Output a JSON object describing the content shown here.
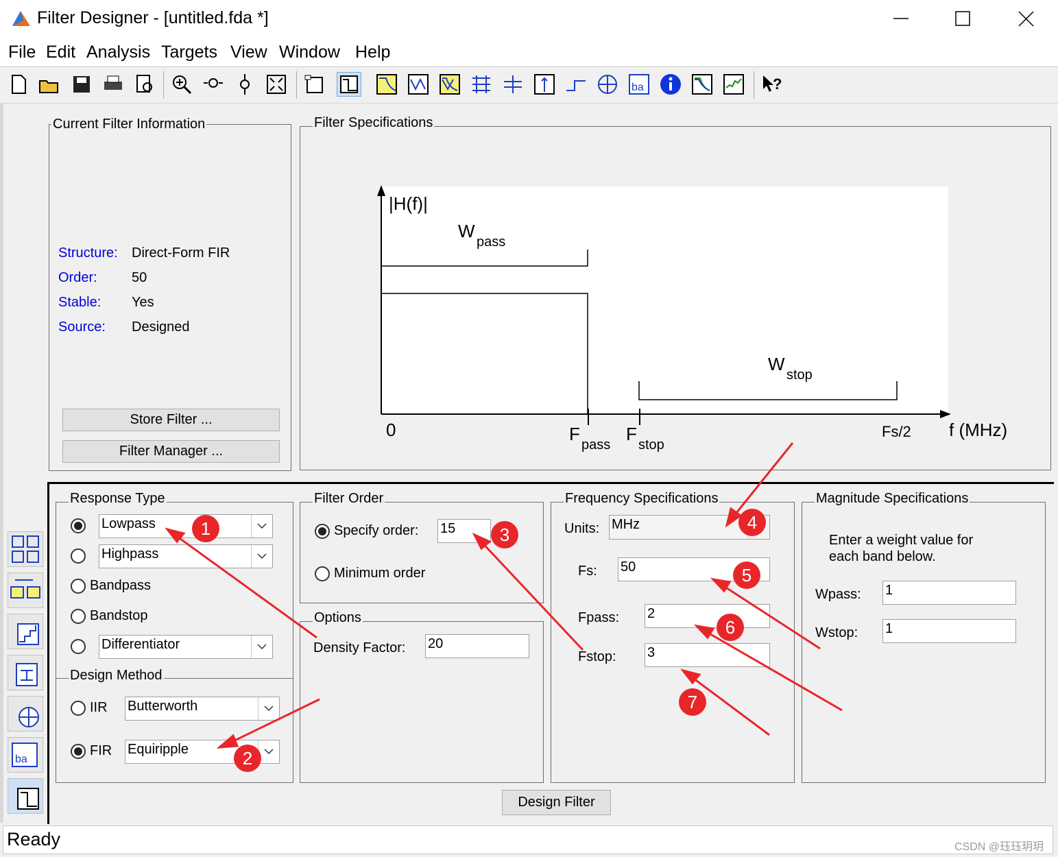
{
  "window": {
    "title": "Filter Designer -  [untitled.fda *]",
    "controls": {
      "minimize": "minimize-icon",
      "maximize": "maximize-icon",
      "close": "close-icon"
    }
  },
  "menu": [
    "File",
    "Edit",
    "Analysis",
    "Targets",
    "View",
    "Window",
    "Help"
  ],
  "toolbar_icons": [
    "new-icon",
    "open-icon",
    "save-icon",
    "print-icon",
    "print-preview-icon",
    "zoom-in-icon",
    "zoom-x-icon",
    "zoom-y-icon",
    "full-view-icon",
    "new-figure-icon",
    "filter-specs-icon",
    "magnitude-response-icon",
    "phase-response-icon",
    "magnitude-phase-icon",
    "group-delay-icon",
    "phase-delay-icon",
    "impulse-response-icon",
    "step-response-icon",
    "pole-zero-icon",
    "coefficients-icon",
    "filter-info-icon",
    "magnitude-estimate-icon",
    "round-off-noise-icon",
    "whats-this-icon"
  ],
  "current_filter": {
    "legend": "Current Filter Information",
    "structure_label": "Structure:",
    "structure_value": "Direct-Form FIR",
    "order_label": "Order:",
    "order_value": "50",
    "stable_label": "Stable:",
    "stable_value": "Yes",
    "source_label": "Source:",
    "source_value": "Designed",
    "store_button": "Store Filter ...",
    "manager_button": "Filter Manager ..."
  },
  "filter_specs": {
    "legend": "Filter Specifications",
    "y_label": "|H(f)|",
    "x_label": "f (MHz)",
    "w_pass": "W",
    "w_pass_sub": "pass",
    "w_stop": "W",
    "w_stop_sub": "stop",
    "zero": "0",
    "f_pass": "F",
    "f_pass_sub": "pass",
    "f_stop": "F",
    "f_stop_sub": "stop",
    "fs_half": "Fs/2"
  },
  "response_type": {
    "legend": "Response Type",
    "lowpass": "Lowpass",
    "highpass": "Highpass",
    "bandpass": "Bandpass",
    "bandstop": "Bandstop",
    "differentiator": "Differentiator",
    "selected": "Lowpass"
  },
  "design_method": {
    "legend": "Design Method",
    "iir_label": "IIR",
    "iir_value": "Butterworth",
    "fir_label": "FIR",
    "fir_value": "Equiripple",
    "selected": "FIR"
  },
  "filter_order": {
    "legend": "Filter Order",
    "specify_label": "Specify order:",
    "specify_value": "15",
    "minimum_label": "Minimum order",
    "selected": "Specify order"
  },
  "options": {
    "legend": "Options",
    "density_label": "Density Factor:",
    "density_value": "20"
  },
  "frequency": {
    "legend": "Frequency Specifications",
    "units_label": "Units:",
    "units_value": "MHz",
    "fs_label": "Fs:",
    "fs_value": "50",
    "fpass_label": "Fpass:",
    "fpass_value": "2",
    "fstop_label": "Fstop:",
    "fstop_value": "3"
  },
  "magnitude": {
    "legend": "Magnitude Specifications",
    "hint_line1": "Enter a weight value for",
    "hint_line2": "each band below.",
    "wpass_label": "Wpass:",
    "wpass_value": "1",
    "wstop_label": "Wstop:",
    "wstop_value": "1"
  },
  "design_button": "Design Filter",
  "status": "Ready",
  "watermark": "CSDN @珏珏玥玥",
  "annotations": [
    "1",
    "2",
    "3",
    "4",
    "5",
    "6",
    "7"
  ],
  "colors": {
    "annotation": "#e8262a",
    "label_blue": "#0000d9",
    "toolbar_active": "#cfe0f5"
  }
}
